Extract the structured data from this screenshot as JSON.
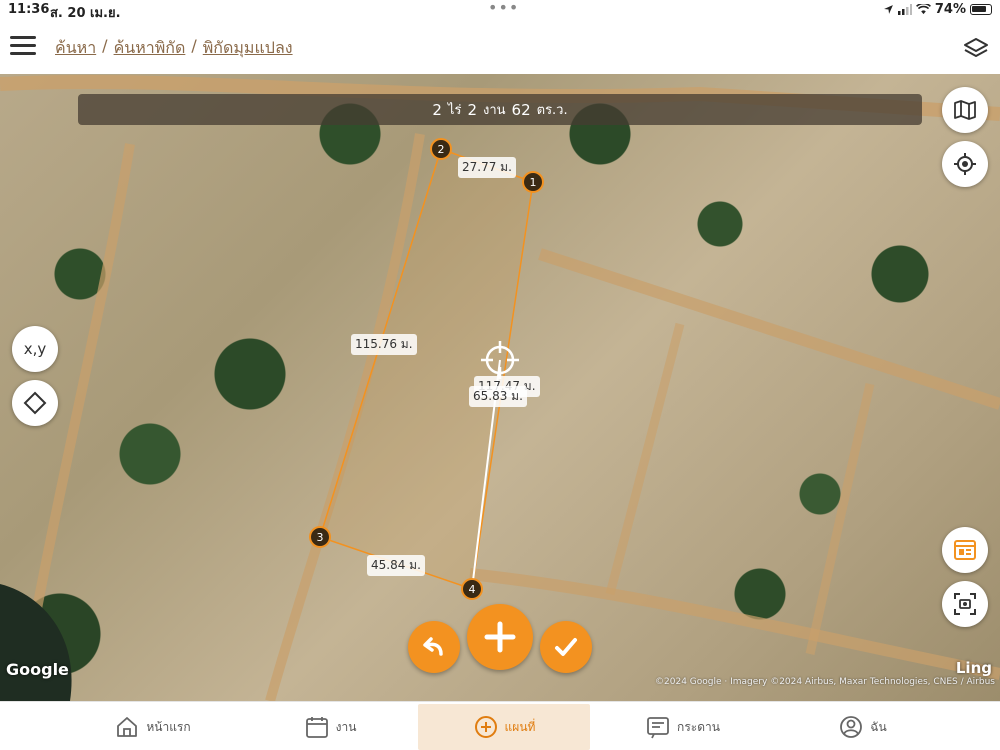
{
  "status_bar": {
    "time": "11:36",
    "date": "ส. 20 เม.ย.",
    "battery": "74%"
  },
  "header": {
    "breadcrumb": [
      "ค้นหา",
      "ค้นหาพิกัด",
      "พิกัดมุมแปลง"
    ]
  },
  "area": {
    "rai_value": "2",
    "rai_unit": "ไร่",
    "ngan_value": "2",
    "ngan_unit": "งาน",
    "wa_value": "62",
    "wa_unit": "ตร.ว."
  },
  "map": {
    "xy_button": "x,y",
    "vertices": [
      "1",
      "2",
      "3",
      "4"
    ],
    "edge_labels": {
      "top": "27.77 ม.",
      "left": "115.76 ม.",
      "right": "117.47 ม.",
      "bottom": "45.84 ม.",
      "cursor": "65.83 ม."
    },
    "google_logo": "Google",
    "ling_logo": "Ling",
    "attribution": "©2024 Google · Imagery ©2024 Airbus, Maxar Technologies, CNES / Airbus",
    "accent_color": "#f39220"
  },
  "tabs": [
    {
      "label": "หน้าแรก",
      "icon": "home-icon"
    },
    {
      "label": "งาน",
      "icon": "calendar-icon"
    },
    {
      "label": "แผนที่",
      "icon": "plus-circle-icon"
    },
    {
      "label": "กระดาน",
      "icon": "board-icon"
    },
    {
      "label": "ฉัน",
      "icon": "user-icon"
    }
  ]
}
